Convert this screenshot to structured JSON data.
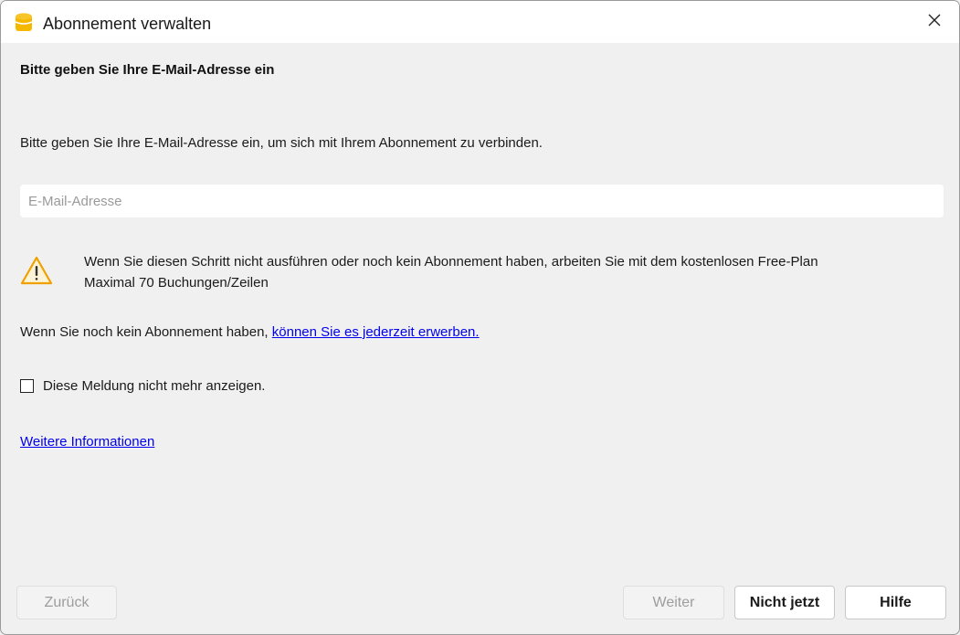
{
  "window": {
    "title": "Abonnement verwalten",
    "app_icon": "database-icon",
    "close_icon": "close-icon"
  },
  "content": {
    "heading": "Bitte geben Sie Ihre E-Mail-Adresse ein",
    "description": "Bitte geben Sie Ihre E-Mail-Adresse ein, um sich mit Ihrem Abonnement zu verbinden.",
    "email": {
      "value": "",
      "placeholder": "E-Mail-Adresse"
    },
    "warning": {
      "icon": "warning-icon",
      "line1": "Wenn Sie diesen Schritt nicht ausführen oder noch kein Abonnement haben, arbeiten Sie mit dem kostenlosen Free-Plan",
      "line2": "Maximal 70 Buchungen/Zeilen"
    },
    "purchase_text": "Wenn Sie noch kein Abonnement haben, ",
    "purchase_link": "können Sie es jederzeit erwerben.",
    "checkbox_label": "Diese Meldung nicht mehr anzeigen.",
    "checkbox_checked": false,
    "more_info_link": "Weitere Informationen"
  },
  "buttons": {
    "back": "Zurück",
    "next": "Weiter",
    "not_now": "Nicht jetzt",
    "help": "Hilfe"
  },
  "colors": {
    "link": "#0000ee",
    "app_icon": "#f5b800",
    "warning": "#f0a000"
  }
}
